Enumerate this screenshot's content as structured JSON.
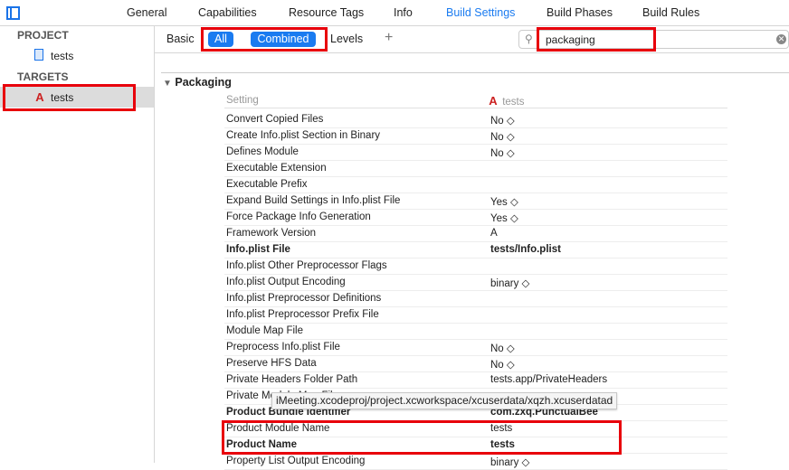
{
  "tabs": [
    {
      "label": "General"
    },
    {
      "label": "Capabilities"
    },
    {
      "label": "Resource Tags"
    },
    {
      "label": "Info"
    },
    {
      "label": "Build Settings",
      "active": true
    },
    {
      "label": "Build Phases"
    },
    {
      "label": "Build Rules"
    }
  ],
  "sidebar": {
    "project_header": "PROJECT",
    "project_item": "tests",
    "targets_header": "TARGETS",
    "target_item": "tests"
  },
  "filter": {
    "basic": "Basic",
    "all": "All",
    "combined": "Combined",
    "levels": "Levels",
    "add": "+"
  },
  "search": {
    "value": "packaging"
  },
  "group": {
    "title": "Packaging",
    "col_setting": "Setting",
    "col_target": "tests"
  },
  "rows": [
    {
      "label": "Convert Copied Files",
      "value": "No ◇"
    },
    {
      "label": "Create Info.plist Section in Binary",
      "value": "No ◇"
    },
    {
      "label": "Defines Module",
      "value": "No ◇"
    },
    {
      "label": "Executable Extension",
      "value": ""
    },
    {
      "label": "Executable Prefix",
      "value": ""
    },
    {
      "label": "Expand Build Settings in Info.plist File",
      "value": "Yes ◇"
    },
    {
      "label": "Force Package Info Generation",
      "value": "Yes ◇"
    },
    {
      "label": "Framework Version",
      "value": "A"
    },
    {
      "label": "Info.plist File",
      "value": "tests/Info.plist",
      "bold": true
    },
    {
      "label": "Info.plist Other Preprocessor Flags",
      "value": ""
    },
    {
      "label": "Info.plist Output Encoding",
      "value": "binary ◇"
    },
    {
      "label": "Info.plist Preprocessor Definitions",
      "value": ""
    },
    {
      "label": "Info.plist Preprocessor Prefix File",
      "value": ""
    },
    {
      "label": "Module Map File",
      "value": ""
    },
    {
      "label": "Preprocess Info.plist File",
      "value": "No ◇"
    },
    {
      "label": "Preserve HFS Data",
      "value": "No ◇"
    },
    {
      "label": "Private Headers Folder Path",
      "value": "tests.app/PrivateHeaders"
    },
    {
      "label": "Private Module Map File",
      "value": ""
    },
    {
      "label": "Product Bundle Identifier",
      "value": "com.zxq.PunctualBee",
      "bold": true
    },
    {
      "label": "Product Module Name",
      "value": "tests"
    },
    {
      "label": "Product Name",
      "value": "tests",
      "bold": true
    },
    {
      "label": "Property List Output Encoding",
      "value": "binary ◇"
    }
  ],
  "tooltip": "iMeeting.xcodeproj/project.xcworkspace/xcuserdata/xqzh.xcuserdatad",
  "colors": {
    "accent": "#1a7bf0",
    "highlight": "#e8000b"
  }
}
